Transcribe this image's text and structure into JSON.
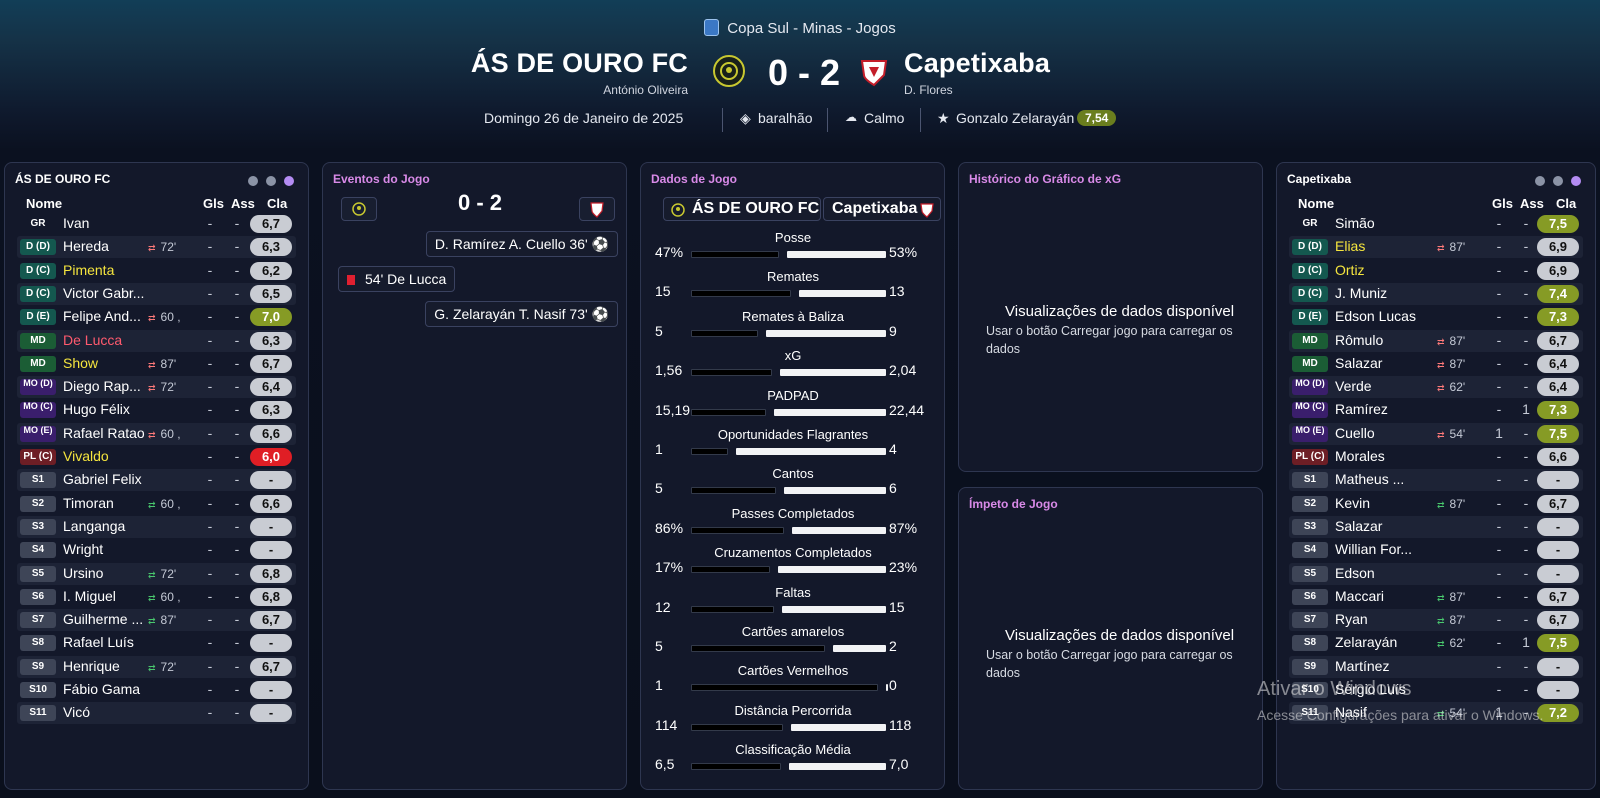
{
  "competition": "Copa Sul - Minas - Jogos",
  "home": {
    "name": "ÁS DE OURO FC",
    "manager": "António Oliveira",
    "crest_color": "#c8c830"
  },
  "away": {
    "name": "Capetixaba",
    "manager": "D. Flores",
    "crest_color": "#c41e2a"
  },
  "score": "0 - 2",
  "date": "Domingo 26 de Janeiro de 2025",
  "stadium": "baralhão",
  "weather": "Calmo",
  "mom": {
    "name": "Gonzalo Zelarayán",
    "rating": "7,54"
  },
  "panels": {
    "events": "Eventos do Jogo",
    "stats": "Dados de Jogo",
    "xg": "Histórico do Gráfico de xG",
    "momentum": "Ímpeto de Jogo"
  },
  "columns": {
    "name": "Nome",
    "goals": "Gls",
    "assists": "Ass",
    "rating": "Cla"
  },
  "home_players": [
    {
      "pos": "GR",
      "name": "Ivan",
      "sub": "",
      "g": "-",
      "a": "-",
      "r": "6,7"
    },
    {
      "pos": "D (D)",
      "name": "Hereda",
      "sub": "72'",
      "g": "-",
      "a": "-",
      "r": "6,3"
    },
    {
      "pos": "D (C)",
      "name": "Pimenta",
      "sub": "",
      "g": "-",
      "a": "-",
      "r": "6,2"
    },
    {
      "pos": "D (C)",
      "name": "Victor Gabr...",
      "sub": "",
      "g": "-",
      "a": "-",
      "r": "6,5"
    },
    {
      "pos": "D (E)",
      "name": "Felipe And...",
      "sub": "60\n,",
      "g": "-",
      "a": "-",
      "r": "7,0"
    },
    {
      "pos": "MD",
      "name": "De Lucca",
      "sub": "",
      "g": "-",
      "a": "-",
      "r": "6,3"
    },
    {
      "pos": "MD",
      "name": "Show",
      "sub": "87'",
      "g": "-",
      "a": "-",
      "r": "6,7"
    },
    {
      "pos": "MO (D)",
      "name": "Diego Rap...",
      "sub": "72'",
      "g": "-",
      "a": "-",
      "r": "6,4"
    },
    {
      "pos": "MO (C)",
      "name": "Hugo Félix",
      "sub": "",
      "g": "-",
      "a": "-",
      "r": "6,3"
    },
    {
      "pos": "MO (E)",
      "name": "Rafael Ratao",
      "sub": "60\n,",
      "g": "-",
      "a": "-",
      "r": "6,6"
    },
    {
      "pos": "PL (C)",
      "name": "Vivaldo",
      "sub": "",
      "g": "-",
      "a": "-",
      "r": "6,0"
    },
    {
      "pos": "S1",
      "name": "Gabriel Felix",
      "sub": "",
      "g": "-",
      "a": "-",
      "r": "-"
    },
    {
      "pos": "S2",
      "name": "Timoran",
      "sub": "60\n,",
      "g": "-",
      "a": "-",
      "r": "6,6"
    },
    {
      "pos": "S3",
      "name": "Langanga",
      "sub": "",
      "g": "-",
      "a": "-",
      "r": "-"
    },
    {
      "pos": "S4",
      "name": "Wright",
      "sub": "",
      "g": "-",
      "a": "-",
      "r": "-"
    },
    {
      "pos": "S5",
      "name": "Ursino",
      "sub": "72'",
      "g": "-",
      "a": "-",
      "r": "6,8"
    },
    {
      "pos": "S6",
      "name": "I. Miguel",
      "sub": "60\n,",
      "g": "-",
      "a": "-",
      "r": "6,8"
    },
    {
      "pos": "S7",
      "name": "Guilherme ...",
      "sub": "87'",
      "g": "-",
      "a": "-",
      "r": "6,7"
    },
    {
      "pos": "S8",
      "name": "Rafael Luís",
      "sub": "",
      "g": "-",
      "a": "-",
      "r": "-"
    },
    {
      "pos": "S9",
      "name": "Henrique",
      "sub": "72'",
      "g": "-",
      "a": "-",
      "r": "6,7"
    },
    {
      "pos": "S10",
      "name": "Fábio Gama",
      "sub": "",
      "g": "-",
      "a": "-",
      "r": "-"
    },
    {
      "pos": "S11",
      "name": "Vicó",
      "sub": "",
      "g": "-",
      "a": "-",
      "r": "-"
    }
  ],
  "away_players": [
    {
      "pos": "GR",
      "name": "Simão",
      "sub": "",
      "g": "-",
      "a": "-",
      "r": "7,5"
    },
    {
      "pos": "D (D)",
      "name": "Elias",
      "sub": "87'",
      "g": "-",
      "a": "-",
      "r": "6,9"
    },
    {
      "pos": "D (C)",
      "name": "Ortiz",
      "sub": "",
      "g": "-",
      "a": "-",
      "r": "6,9"
    },
    {
      "pos": "D (C)",
      "name": "J. Muniz",
      "sub": "",
      "g": "-",
      "a": "-",
      "r": "7,4"
    },
    {
      "pos": "D (E)",
      "name": "Edson Lucas",
      "sub": "",
      "g": "-",
      "a": "-",
      "r": "7,3"
    },
    {
      "pos": "MD",
      "name": "Rômulo",
      "sub": "87'",
      "g": "-",
      "a": "-",
      "r": "6,7"
    },
    {
      "pos": "MD",
      "name": "Salazar",
      "sub": "87'",
      "g": "-",
      "a": "-",
      "r": "6,4"
    },
    {
      "pos": "MO (D)",
      "name": "Verde",
      "sub": "62'",
      "g": "-",
      "a": "-",
      "r": "6,4"
    },
    {
      "pos": "MO (C)",
      "name": "Ramírez",
      "sub": "",
      "g": "-",
      "a": "1",
      "r": "7,3"
    },
    {
      "pos": "MO (E)",
      "name": "Cuello",
      "sub": "54'",
      "g": "1",
      "a": "-",
      "r": "7,5"
    },
    {
      "pos": "PL (C)",
      "name": "Morales",
      "sub": "",
      "g": "-",
      "a": "-",
      "r": "6,6"
    },
    {
      "pos": "S1",
      "name": "Matheus ...",
      "sub": "",
      "g": "-",
      "a": "-",
      "r": "-"
    },
    {
      "pos": "S2",
      "name": "Kevin",
      "sub": "87'",
      "g": "-",
      "a": "-",
      "r": "6,7"
    },
    {
      "pos": "S3",
      "name": "Salazar",
      "sub": "",
      "g": "-",
      "a": "-",
      "r": "-"
    },
    {
      "pos": "S4",
      "name": "Willian For...",
      "sub": "",
      "g": "-",
      "a": "-",
      "r": "-"
    },
    {
      "pos": "S5",
      "name": "Edson",
      "sub": "",
      "g": "-",
      "a": "-",
      "r": "-"
    },
    {
      "pos": "S6",
      "name": "Maccari",
      "sub": "87'",
      "g": "-",
      "a": "-",
      "r": "6,7"
    },
    {
      "pos": "S7",
      "name": "Ryan",
      "sub": "87'",
      "g": "-",
      "a": "-",
      "r": "6,7"
    },
    {
      "pos": "S8",
      "name": "Zelarayán",
      "sub": "62'",
      "g": "-",
      "a": "1",
      "r": "7,5"
    },
    {
      "pos": "S9",
      "name": "Martínez",
      "sub": "",
      "g": "-",
      "a": "-",
      "r": "-"
    },
    {
      "pos": "S10",
      "name": "Sérgio Luís",
      "sub": "",
      "g": "-",
      "a": "-",
      "r": "-"
    },
    {
      "pos": "S11",
      "name": "Nasif",
      "sub": "54'",
      "g": "1",
      "a": "-",
      "r": "7,2"
    }
  ],
  "events": [
    {
      "text": "D. Ramírez  A. Cuello 36'",
      "side": "away",
      "type": "goal"
    },
    {
      "text": "54'  De Lucca",
      "side": "home",
      "type": "red"
    },
    {
      "text": "G. Zelarayán  T. Nasif 73'",
      "side": "away",
      "type": "goal"
    }
  ],
  "stats": [
    {
      "label": "Posse",
      "home": "47%",
      "away": "53%",
      "h": 47,
      "a": 53
    },
    {
      "label": "Remates",
      "home": "15",
      "away": "13",
      "h": 15,
      "a": 13
    },
    {
      "label": "Remates à Baliza",
      "home": "5",
      "away": "9",
      "h": 5,
      "a": 9
    },
    {
      "label": "xG",
      "home": "1,56",
      "away": "2,04",
      "h": 1.56,
      "a": 2.04
    },
    {
      "label": "PADPAD",
      "home": "15,19",
      "away": "22,44",
      "h": 15.19,
      "a": 22.44
    },
    {
      "label": "Oportunidades Flagrantes",
      "home": "1",
      "away": "4",
      "h": 1,
      "a": 4
    },
    {
      "label": "Cantos",
      "home": "5",
      "away": "6",
      "h": 5,
      "a": 6
    },
    {
      "label": "Passes Completados",
      "home": "86%",
      "away": "87%",
      "h": 86,
      "a": 87
    },
    {
      "label": "Cruzamentos Completados",
      "home": "17%",
      "away": "23%",
      "h": 17,
      "a": 23
    },
    {
      "label": "Faltas",
      "home": "12",
      "away": "15",
      "h": 12,
      "a": 15
    },
    {
      "label": "Cartões amarelos",
      "home": "5",
      "away": "2",
      "h": 5,
      "a": 2
    },
    {
      "label": "Cartões Vermelhos",
      "home": "1",
      "away": "0",
      "h": 1,
      "a": 0
    },
    {
      "label": "Distância Percorrida",
      "home": "114",
      "away": "118",
      "h": 114,
      "a": 118
    },
    {
      "label": "Classificação Média",
      "home": "6,5",
      "away": "7,0",
      "h": 6.5,
      "a": 7.0
    }
  ],
  "empty": {
    "title": "Visualizações de dados disponível",
    "desc": "Usar o botão Carregar jogo para carregar os dados"
  },
  "watermark": {
    "line1": "Ativar o Windows",
    "line2": "Acesse Configurações para ativar o Windows."
  }
}
